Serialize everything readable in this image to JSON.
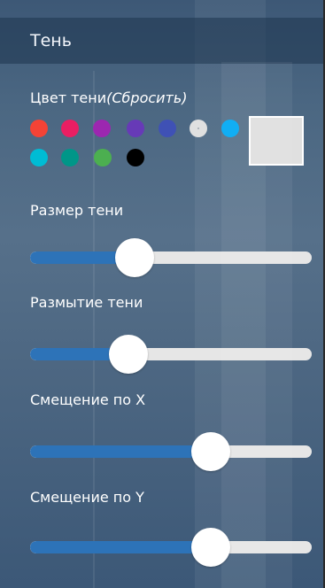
{
  "panel": {
    "title": "Тень"
  },
  "shadow_color": {
    "label": "Цвет тени",
    "reset_label": "(Сбросить)",
    "swatches": [
      {
        "name": "red",
        "color": "#f44336"
      },
      {
        "name": "pink",
        "color": "#e91e63"
      },
      {
        "name": "purple",
        "color": "#9c27b0"
      },
      {
        "name": "deep-purple",
        "color": "#673ab7"
      },
      {
        "name": "indigo",
        "color": "#3f51b5"
      },
      {
        "name": "light-gray",
        "color": "#e0e0e0"
      },
      {
        "name": "blue",
        "color": "#03a9f4"
      },
      {
        "name": "cyan",
        "color": "#00bcd4"
      },
      {
        "name": "teal",
        "color": "#009688"
      },
      {
        "name": "green",
        "color": "#4caf50"
      },
      {
        "name": "black",
        "color": "#000000"
      }
    ],
    "selected": "light-gray",
    "preview_color": "#e0e0e0"
  },
  "sliders": [
    {
      "label": "Размер тени",
      "value_fraction": 0.37
    },
    {
      "label": "Размытие тени",
      "value_fraction": 0.35
    },
    {
      "label": "Смещение по X",
      "value_fraction": 0.64
    },
    {
      "label": "Смещение по Y",
      "value_fraction": 0.64
    }
  ],
  "colors": {
    "slider_fill": "#2d73b8",
    "slider_track": "#e6e6e6",
    "header_bg": "#1d344e"
  }
}
